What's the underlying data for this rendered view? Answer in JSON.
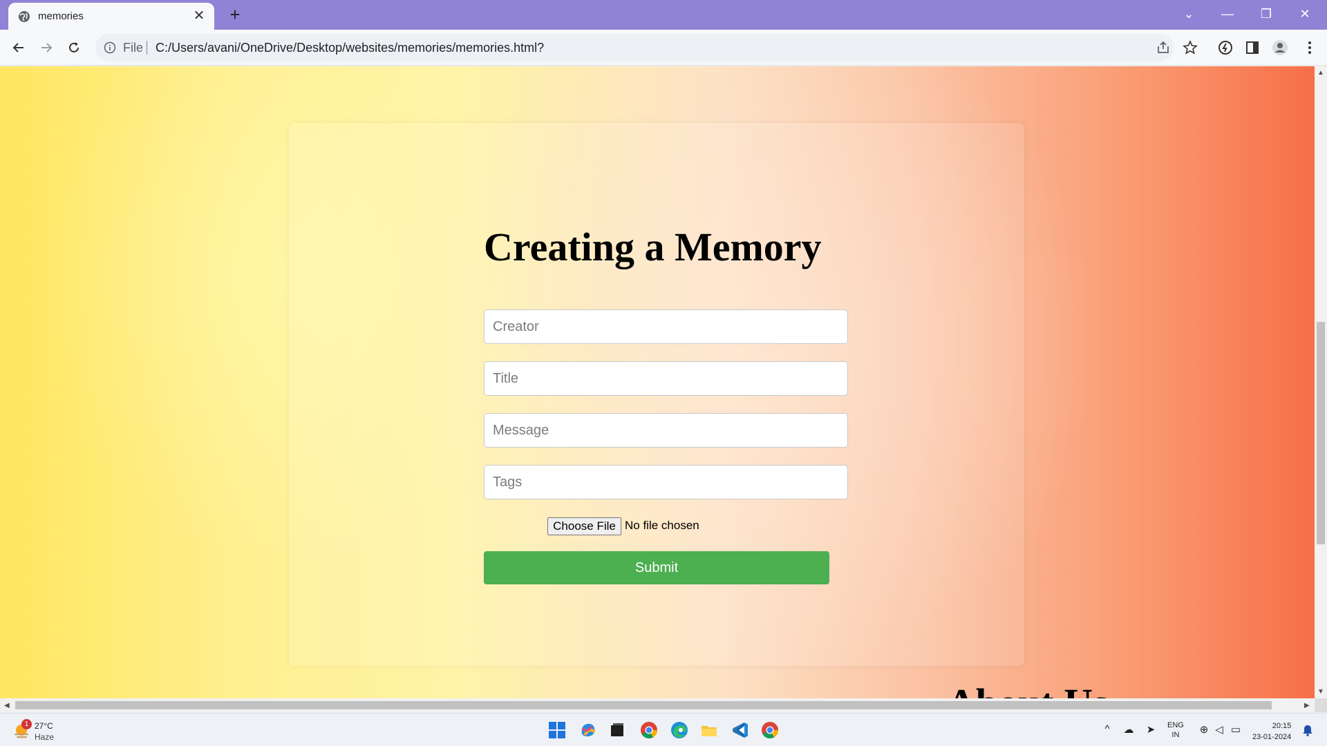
{
  "browser": {
    "tab_title": "memories",
    "new_tab_label": "+",
    "address": {
      "scheme_label": "File",
      "url": "C:/Users/avani/OneDrive/Desktop/websites/memories/memories.html?"
    }
  },
  "page": {
    "heading": "Creating a Memory",
    "form": {
      "creator_placeholder": "Creator",
      "title_placeholder": "Title",
      "message_placeholder": "Message",
      "tags_placeholder": "Tags",
      "file_button_label": "Choose File",
      "file_status": "No file chosen",
      "submit_label": "Submit"
    },
    "next_section_heading": "About Us"
  },
  "taskbar": {
    "weather": {
      "temperature": "27°C",
      "condition": "Haze",
      "badge_count": "1"
    },
    "language": {
      "line1": "ENG",
      "line2": "IN"
    },
    "clock": {
      "time": "20:15",
      "date": "23-01-2024"
    },
    "pinned_apps": [
      "start-icon",
      "copilot-icon",
      "terminal-icon",
      "chrome-icon",
      "edge-icon",
      "file-explorer-icon",
      "vscode-icon",
      "chrome-icon"
    ]
  },
  "colors": {
    "titlebar": "#9083d6",
    "submit_button": "#4caf50",
    "background_gradient": [
      "#ffe660",
      "#fff3a8",
      "#fde1c4",
      "#f86e48"
    ]
  }
}
